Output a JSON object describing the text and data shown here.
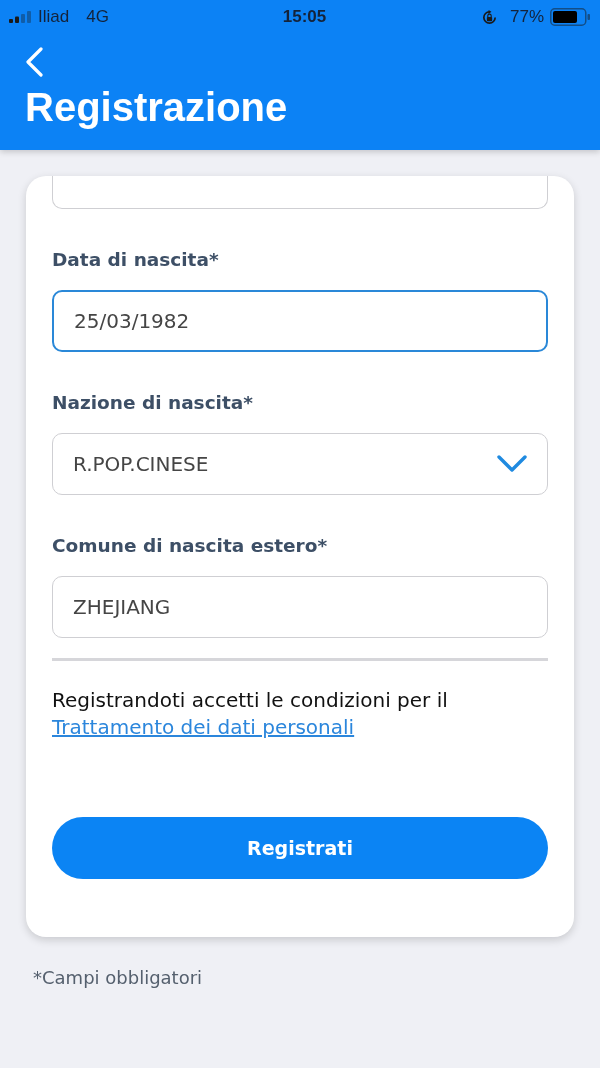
{
  "status_bar": {
    "carrier": "Iliad",
    "network": "4G",
    "time": "15:05",
    "battery": "77%"
  },
  "header": {
    "title": "Registrazione"
  },
  "form": {
    "scrolled_field": {
      "focused": false
    },
    "fields": [
      {
        "label": "Data di nascita*",
        "kind": "input",
        "value": "25/03/1982",
        "focused": true
      },
      {
        "label": "Nazione di nascita*",
        "kind": "select",
        "value": "R.POP.CINESE",
        "focused": false
      },
      {
        "label": "Comune di nascita estero*",
        "kind": "input",
        "value": "ZHEJIANG",
        "focused": false
      }
    ],
    "consent": {
      "text": "Registrandoti accetti le condizioni per il",
      "link": "Trattamento dei dati personali"
    },
    "submit": {
      "label": "Registrati"
    }
  },
  "footnote": "*Campi obbligatori"
}
